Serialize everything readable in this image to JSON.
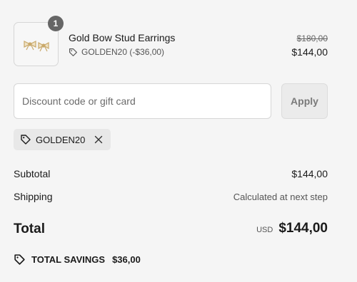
{
  "product": {
    "quantity": "1",
    "title": "Gold Bow Stud Earrings",
    "discount_note": "GOLDEN20 (-$36,00)",
    "original_price": "$180,00",
    "price": "$144,00",
    "image": "gold-bow-earrings-image"
  },
  "discount": {
    "placeholder": "Discount code or gift card",
    "apply_label": "Apply",
    "applied_code": "GOLDEN20"
  },
  "summary": {
    "subtotal_label": "Subtotal",
    "subtotal_value": "$144,00",
    "shipping_label": "Shipping",
    "shipping_value": "Calculated at next step",
    "total_label": "Total",
    "currency": "USD",
    "total_value": "$144,00",
    "savings_label": "TOTAL SAVINGS",
    "savings_value": "$36,00"
  },
  "colors": {
    "background": "#f5f5f5",
    "badge": "#666666",
    "chip": "#e8e8e8",
    "gold": "#c9a96b"
  }
}
